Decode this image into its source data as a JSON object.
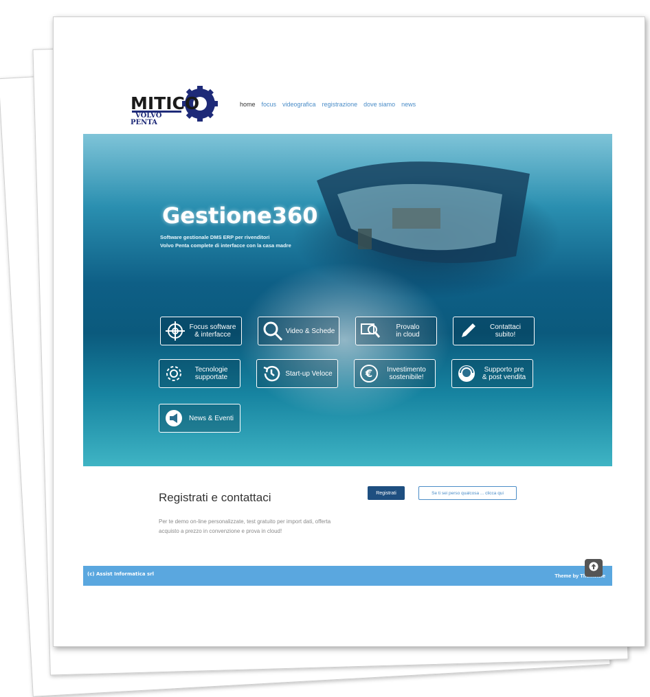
{
  "brand": {
    "logo_main": "MITICO",
    "logo_sub1": "VOLVO",
    "logo_sub2": "PENTA",
    "color_navy": "#1e2a78"
  },
  "nav": {
    "items": [
      "home",
      "focus",
      "videografica",
      "registrazione",
      "dove siamo",
      "news"
    ],
    "active": "home"
  },
  "hero": {
    "title": "Gestione360",
    "subtitle_line1": "Software gestionale DMS ERP per rivenditori",
    "subtitle_line2": "Volvo Penta complete di interfacce con la casa madre",
    "tiles": [
      {
        "label": "Focus software\n& interfacce",
        "icon": "target-icon"
      },
      {
        "label": "Video & Schede",
        "icon": "magnifier-icon"
      },
      {
        "label": "Provalo\nin cloud",
        "icon": "monitor-search-icon"
      },
      {
        "label": "Contattaci\nsubito!",
        "icon": "pencil-icon"
      },
      {
        "label": "Tecnologie\nsupportate",
        "icon": "gear-icon"
      },
      {
        "label": "Start-up Veloce",
        "icon": "history-icon"
      },
      {
        "label": "Investimento\nsostenibile!",
        "icon": "euro-icon"
      },
      {
        "label": "Supporto pre\n& post vendita",
        "icon": "headset-icon"
      },
      {
        "label": "News & Eventi",
        "icon": "megaphone-icon"
      }
    ]
  },
  "cta": {
    "title": "Registrati e contattaci",
    "text": "Per te demo on-line personalizzate, test gratuito per import dati, offerta acquisto a prezzo in convenzione e prova in cloud!",
    "register_button": "Registrati",
    "lost_button": "Se ti sei perso qualcosa ... clicca qui"
  },
  "footer": {
    "left": "(c) Assist Informatica srl",
    "right": "Theme by Themeisle"
  }
}
